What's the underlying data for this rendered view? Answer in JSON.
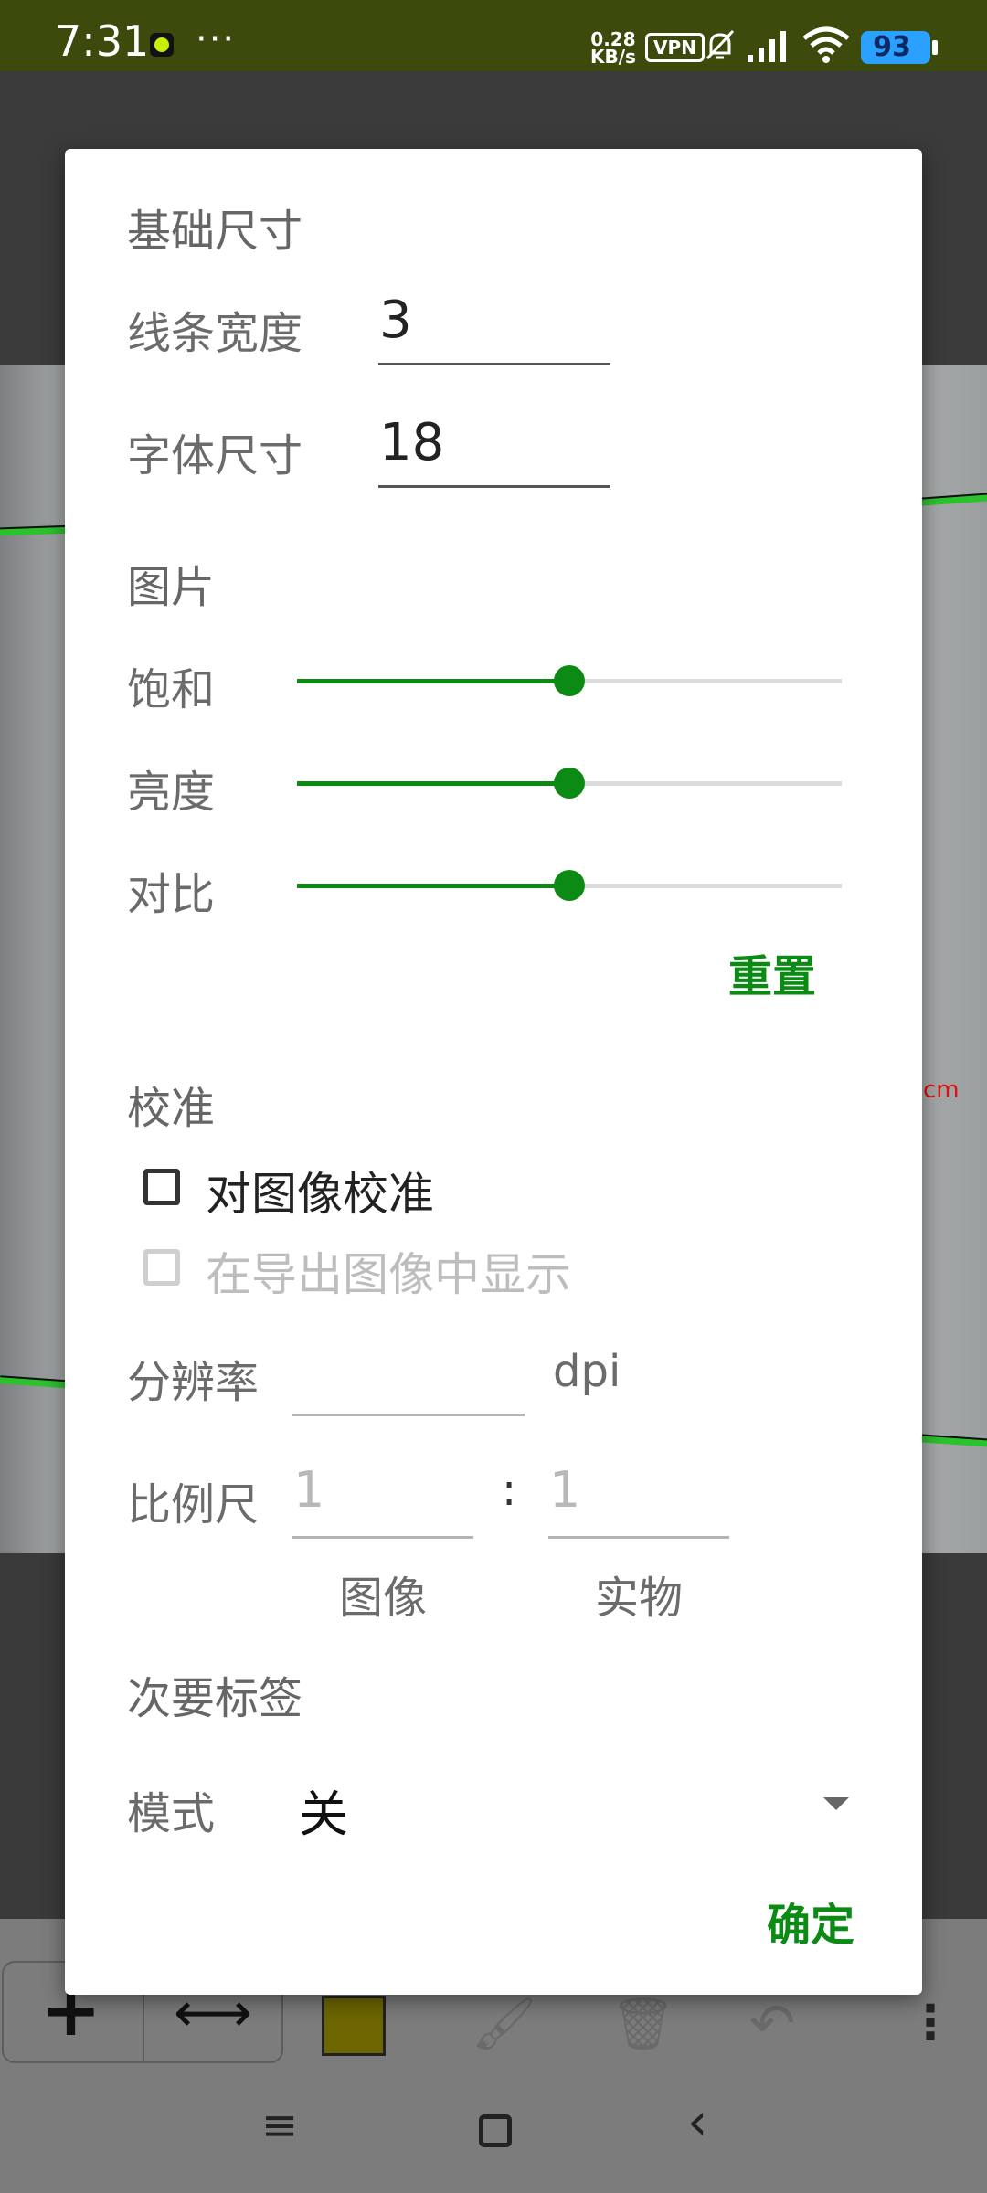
{
  "status_bar": {
    "time": "7:31",
    "more": "···",
    "net_speed_value": "0.28",
    "net_speed_unit": "KB/s",
    "vpn": "VPN",
    "battery": "93"
  },
  "photo": {
    "measure_label": "cm"
  },
  "dialog": {
    "basic_size_title": "基础尺寸",
    "line_width_label": "线条宽度",
    "line_width_value": "3",
    "font_size_label": "字体尺寸",
    "font_size_value": "18",
    "image_title": "图片",
    "saturation": {
      "label": "饱和",
      "level": 0.5
    },
    "brightness": {
      "label": "亮度",
      "level": 0.5
    },
    "contrast": {
      "label": "对比",
      "level": 0.5
    },
    "reset_label": "重置",
    "calibration_title": "校准",
    "calibrate_checkbox_label": "对图像校准",
    "calibrate_checked": false,
    "show_export_label": "在导出图像中显示",
    "show_export_checked": false,
    "resolution_label": "分辨率",
    "resolution_value": "",
    "resolution_unit": "dpi",
    "scale_label": "比例尺",
    "scale_image_placeholder": "1",
    "scale_separator": ":",
    "scale_real_placeholder": "1",
    "scale_image_caption": "图像",
    "scale_real_caption": "实物",
    "secondary_label_title": "次要标签",
    "mode_label": "模式",
    "mode_value": "关",
    "ok_label": "确定"
  },
  "colors": {
    "accent": "#0b8a14",
    "status_bar": "#3c4a0c",
    "battery": "#2aa0ff"
  },
  "toolbar": {
    "icons": [
      "plus-icon",
      "double-arrow-icon",
      "color-swatch",
      "brush-icon",
      "trash-icon",
      "undo-icon",
      "more-vert-icon"
    ]
  },
  "nav_bar": {
    "icons": [
      "menu-icon",
      "home-icon",
      "back-icon"
    ]
  }
}
